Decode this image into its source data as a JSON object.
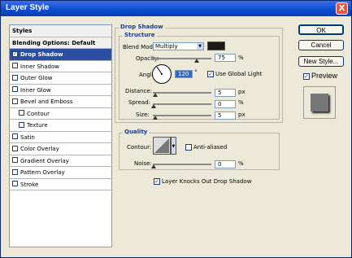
{
  "window": {
    "title": "Layer Style",
    "close": "X"
  },
  "styles_list": {
    "header": "Styles",
    "blending": "Blending Options: Default",
    "items": [
      {
        "label": "Drop Shadow",
        "checked": true,
        "selected": true,
        "sub": false
      },
      {
        "label": "Inner Shadow",
        "checked": false,
        "selected": false,
        "sub": false
      },
      {
        "label": "Outer Glow",
        "checked": false,
        "selected": false,
        "sub": false
      },
      {
        "label": "Inner Glow",
        "checked": false,
        "selected": false,
        "sub": false
      },
      {
        "label": "Bevel and Emboss",
        "checked": false,
        "selected": false,
        "sub": false
      },
      {
        "label": "Contour",
        "checked": false,
        "selected": false,
        "sub": true
      },
      {
        "label": "Texture",
        "checked": false,
        "selected": false,
        "sub": true
      },
      {
        "label": "Satin",
        "checked": false,
        "selected": false,
        "sub": false
      },
      {
        "label": "Color Overlay",
        "checked": false,
        "selected": false,
        "sub": false
      },
      {
        "label": "Gradient Overlay",
        "checked": false,
        "selected": false,
        "sub": false
      },
      {
        "label": "Pattern Overlay",
        "checked": false,
        "selected": false,
        "sub": false
      },
      {
        "label": "Stroke",
        "checked": false,
        "selected": false,
        "sub": false
      }
    ]
  },
  "drop_shadow": {
    "title": "Drop Shadow",
    "structure": "Structure",
    "blend_mode_label": "Blend Mode:",
    "blend_mode": "Multiply",
    "shadow_color": "#1a1a1a",
    "opacity_label": "Opacity:",
    "opacity": "75",
    "opacity_level": 0.75,
    "percent": "%",
    "angle_label": "Angle:",
    "angle": "120",
    "degree": "°",
    "global_light_label": "Use Global Light",
    "global_light": true,
    "distance_label": "Distance:",
    "distance": "5",
    "spread_label": "Spread:",
    "spread": "0",
    "size_label": "Size:",
    "size": "5",
    "px": "px",
    "quality": "Quality",
    "contour_label": "Contour:",
    "anti_aliased_label": "Anti-aliased",
    "anti_aliased": false,
    "noise_label": "Noise:",
    "noise": "0",
    "knocks_out_label": "Layer Knocks Out Drop Shadow",
    "knocks_out": true
  },
  "buttons": {
    "ok": "OK",
    "cancel": "Cancel",
    "new_style": "New Style...",
    "preview": "Preview",
    "preview_checked": true
  }
}
